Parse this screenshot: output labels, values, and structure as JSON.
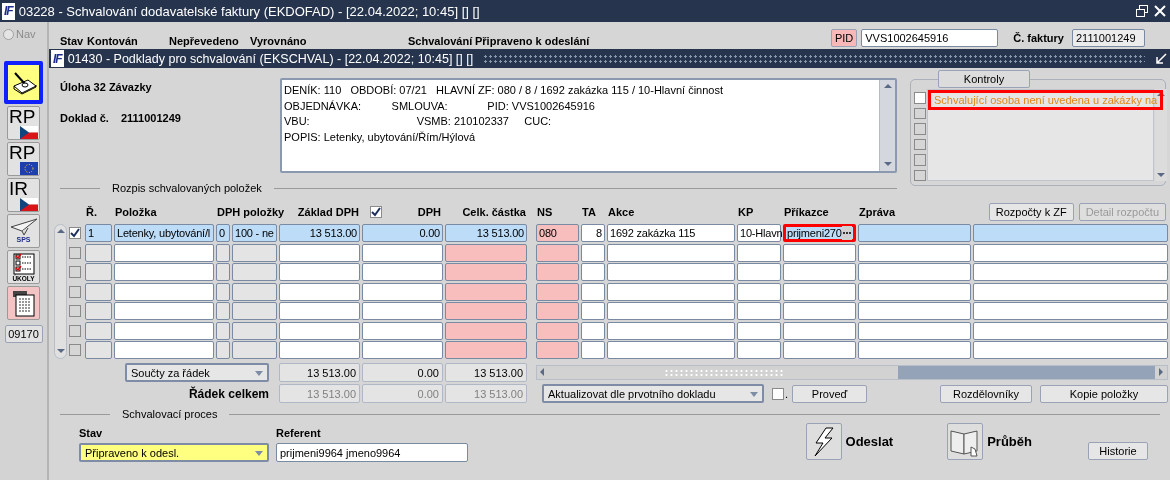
{
  "window": {
    "logo": "IF",
    "title": "03228 - Schvalování dodavatelské faktury (EKDOFAD) - [22.04.2022; 10:45] [] []"
  },
  "nav": {
    "label": "Nav",
    "selected": false
  },
  "toolbar": [
    {
      "kind": "edit",
      "selected": true
    },
    {
      "kind": "flag-cz",
      "label": "RP",
      "selected": false
    },
    {
      "kind": "flag-eu",
      "label": "RP",
      "selected": false
    },
    {
      "kind": "flag-cz",
      "label": "IR",
      "selected": false
    },
    {
      "kind": "plane",
      "label": "SPS",
      "selected": false
    },
    {
      "kind": "checklist",
      "label": "ÚKOLY",
      "selected": false
    },
    {
      "kind": "document",
      "selected": false
    }
  ],
  "code_button": "09170",
  "status": [
    "Stav",
    "Kontován",
    "Nepřevedeno",
    "Vyrovnáno",
    "Schvalování",
    "Připraveno k odeslání"
  ],
  "pid": {
    "label": "PID",
    "value": "VVS1002645916"
  },
  "invoice": {
    "label": "Č. faktury",
    "value": "2111001249"
  },
  "subwindow": {
    "logo": "IF",
    "title": "01430 - Podklady pro schvalování (EKSCHVAL) - [22.04.2022; 10:45] [] []"
  },
  "task": "Úloha 32 Závazky",
  "document": {
    "label": "Doklad č.",
    "value": "2111001249"
  },
  "info_lines": [
    "DENÍK: 110   OBDOBÍ: 07/21   HLAVNÍ ZF: 080 / 8 / 1692 zakázka 115 / 10-Hlavní činnost",
    "OBJEDNÁVKA:          SMLOUVA:             PID: VVS1002645916",
    "VBU:                                   VSMB: 210102337     CUC:",
    "POPIS: Letenky, ubytování/Řím/Hýlová"
  ],
  "kontroly": {
    "tab": "Kontroly",
    "items": [
      {
        "text": "Schvalující osoba není uvedena u zakázky na",
        "checked": false,
        "disabled": false,
        "highlighted": true
      },
      {
        "checked": false,
        "disabled": true
      },
      {
        "checked": false,
        "disabled": true
      },
      {
        "checked": false,
        "disabled": true
      },
      {
        "checked": false,
        "disabled": true
      },
      {
        "checked": false,
        "disabled": true
      }
    ]
  },
  "items_section": "Rozpis schvalovaných položek",
  "table": {
    "columns": [
      "Ř.",
      "Položka",
      "DPH položky",
      "Základ DPH",
      "DPH",
      "Celk. částka",
      "NS",
      "TA",
      "Akce",
      "KP",
      "Příkazce",
      "Zpráva"
    ],
    "header_checked": true,
    "buttons": [
      {
        "label": "Rozpočty k ZF",
        "disabled": false
      },
      {
        "label": "Detail rozpočtu",
        "disabled": true
      }
    ],
    "rows": [
      {
        "selected": true,
        "checked": true,
        "prikazce_marked": true,
        "cells": {
          "r": "1",
          "polozka": "Letenky, ubytování/l",
          "dph_code": "0",
          "dph_text": "100 - ne",
          "zaklad": "13 513.00",
          "dph": "0.00",
          "celkem": "13 513.00",
          "ns": "080",
          "ta": "8",
          "akce": "1692 zakázka 115",
          "kp": "10-Hlavn",
          "prikazce": "prijmeni270"
        }
      },
      {
        "selected": false,
        "checked": false,
        "prikazce_marked": false,
        "cells": {}
      },
      {
        "selected": false,
        "checked": false,
        "prikazce_marked": false,
        "cells": {}
      },
      {
        "selected": false,
        "checked": false,
        "prikazce_marked": false,
        "cells": {}
      },
      {
        "selected": false,
        "checked": false,
        "prikazce_marked": false,
        "cells": {}
      },
      {
        "selected": false,
        "checked": false,
        "prikazce_marked": false,
        "cells": {}
      },
      {
        "selected": false,
        "checked": false,
        "prikazce_marked": false,
        "cells": {}
      }
    ]
  },
  "totals": {
    "mode": "Součty za řádek",
    "values": [
      "13 513.00",
      "0.00",
      "13 513.00"
    ]
  },
  "row_totals": {
    "label": "Řádek celkem",
    "values": [
      "13 513.00",
      "0.00",
      "13 513.00"
    ]
  },
  "update": {
    "select": "Aktualizovat dle prvotního dokladu",
    "checked": false,
    "checkbox_label": ".",
    "button": "Proveď"
  },
  "item_buttons": [
    "Rozdělovníky",
    "Kopie položky"
  ],
  "process": {
    "title": "Schvalovací proces",
    "stav_label": "Stav",
    "stav_value": "Připraveno k odesl.",
    "referent_label": "Referent",
    "referent_value": "prijmeni9964 jmeno9964",
    "send": "Odeslat",
    "progress": "Průběh",
    "history": "Historie"
  }
}
